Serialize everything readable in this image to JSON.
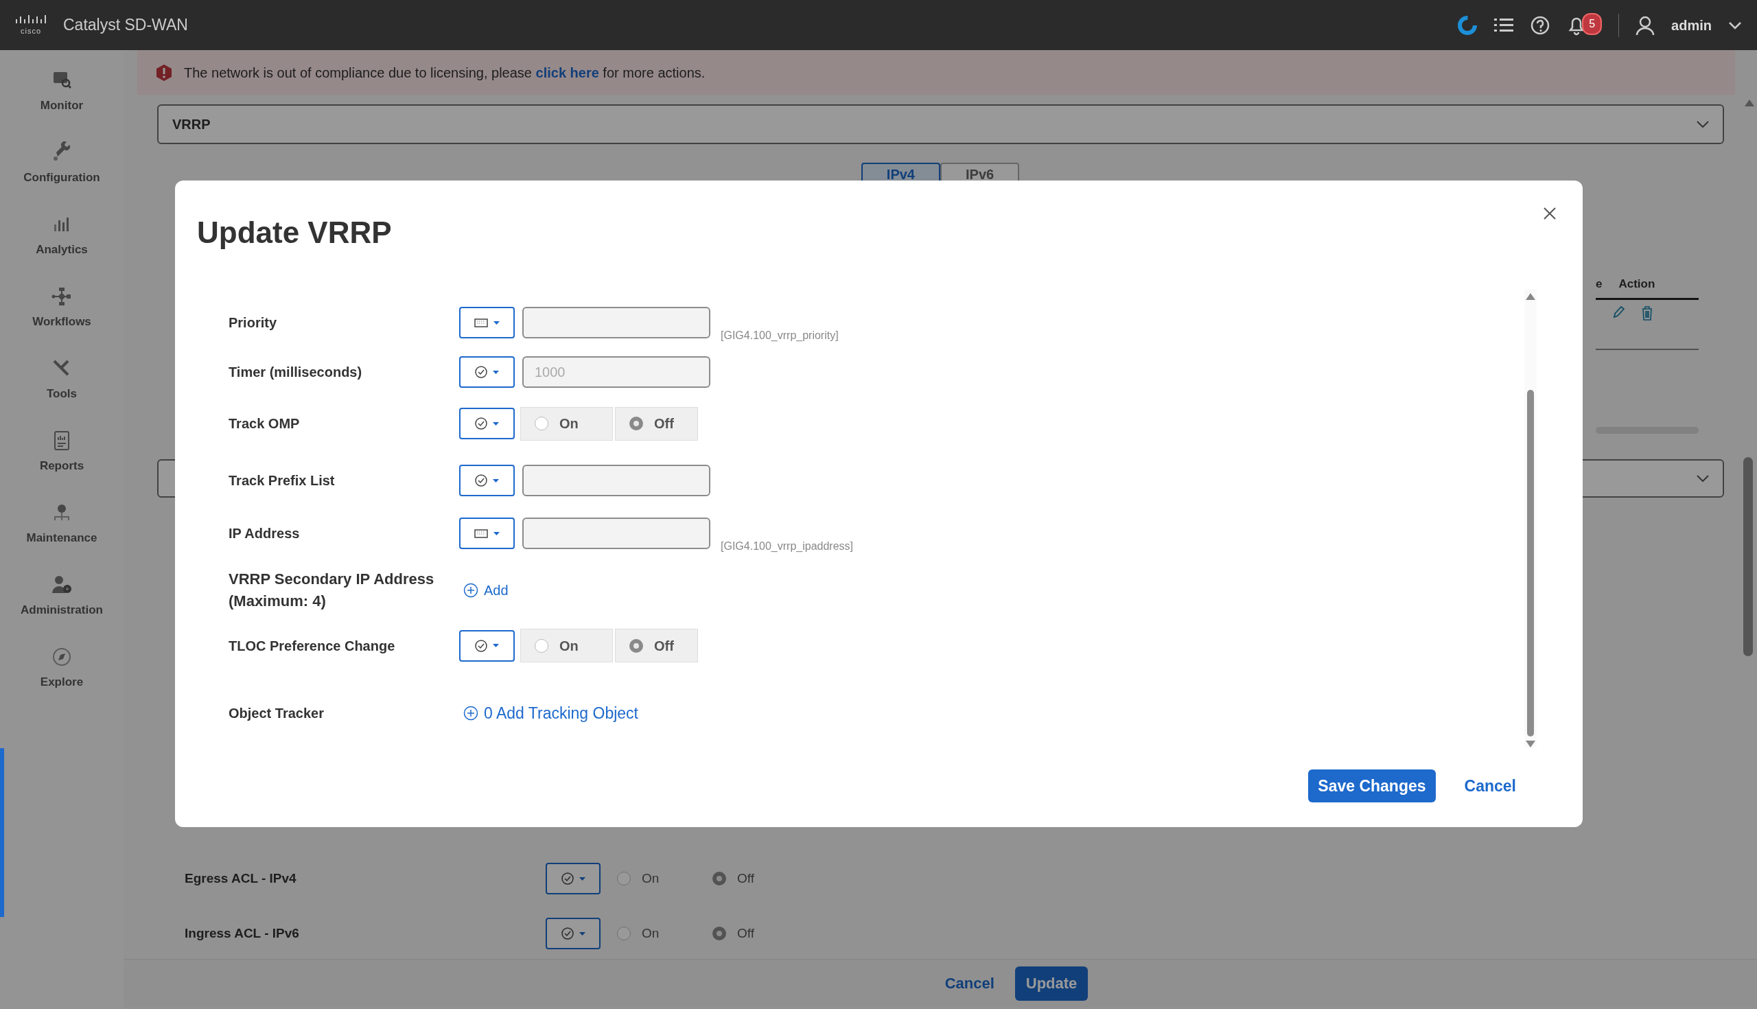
{
  "header": {
    "logo_text": "cisco",
    "product": "Catalyst SD-WAN",
    "notification_count": "5",
    "user": "admin"
  },
  "sidebar": {
    "items": [
      {
        "label": "Monitor"
      },
      {
        "label": "Configuration"
      },
      {
        "label": "Analytics"
      },
      {
        "label": "Workflows"
      },
      {
        "label": "Tools"
      },
      {
        "label": "Reports"
      },
      {
        "label": "Maintenance"
      },
      {
        "label": "Administration"
      },
      {
        "label": "Explore"
      }
    ]
  },
  "banner": {
    "text_before": "The network is out of compliance due to licensing, please ",
    "link": "click here",
    "text_after": " for more actions."
  },
  "feature_select": {
    "value": "VRRP"
  },
  "ip_tabs": [
    {
      "label": "IPv4",
      "selected": true
    },
    {
      "label": "IPv6",
      "selected": false
    }
  ],
  "vrrp_table": {
    "columns": [
      "e",
      "Action"
    ]
  },
  "background_rows": [
    {
      "label": "Egress ACL - IPv4",
      "options": [
        {
          "label": "On",
          "selected": false
        },
        {
          "label": "Off",
          "selected": true
        }
      ]
    },
    {
      "label": "Ingress ACL - IPv6",
      "options": [
        {
          "label": "On",
          "selected": false
        },
        {
          "label": "Off",
          "selected": true
        }
      ]
    }
  ],
  "page_buttons": [
    {
      "label": "Cancel",
      "kind": "link"
    },
    {
      "label": "Update",
      "kind": "primary"
    }
  ],
  "modal": {
    "title": "Update VRRP",
    "fields": [
      {
        "label": "Priority",
        "scope": {
          "kind": "device"
        },
        "kind": "text",
        "hint": "[GIG4.100_vrrp_priority]"
      },
      {
        "label": "Timer (milliseconds)",
        "scope": {
          "kind": "default"
        },
        "kind": "text",
        "placeholder": "1000"
      },
      {
        "label": "Track OMP",
        "scope": {
          "kind": "default"
        },
        "kind": "toggle",
        "options": [
          {
            "label": "On",
            "selected": false
          },
          {
            "label": "Off",
            "selected": true
          }
        ]
      },
      {
        "label": "Track Prefix List",
        "scope": {
          "kind": "default"
        },
        "kind": "text"
      },
      {
        "label": "IP Address",
        "scope": {
          "kind": "device"
        },
        "kind": "text",
        "hint": "[GIG4.100_vrrp_ipaddress]"
      },
      {
        "label": "VRRP Secondary IP Address (Maximum: 4)",
        "kind": "add",
        "action": "Add"
      },
      {
        "label": "TLOC Preference Change",
        "scope": {
          "kind": "default"
        },
        "kind": "toggle",
        "options": [
          {
            "label": "On",
            "selected": false
          },
          {
            "label": "Off",
            "selected": true
          }
        ]
      },
      {
        "label": "Object Tracker",
        "kind": "add",
        "action": "0 Add Tracking Object"
      }
    ],
    "buttons": [
      {
        "label": "Save Changes",
        "kind": "primary"
      },
      {
        "label": "Cancel",
        "kind": "link"
      }
    ]
  }
}
